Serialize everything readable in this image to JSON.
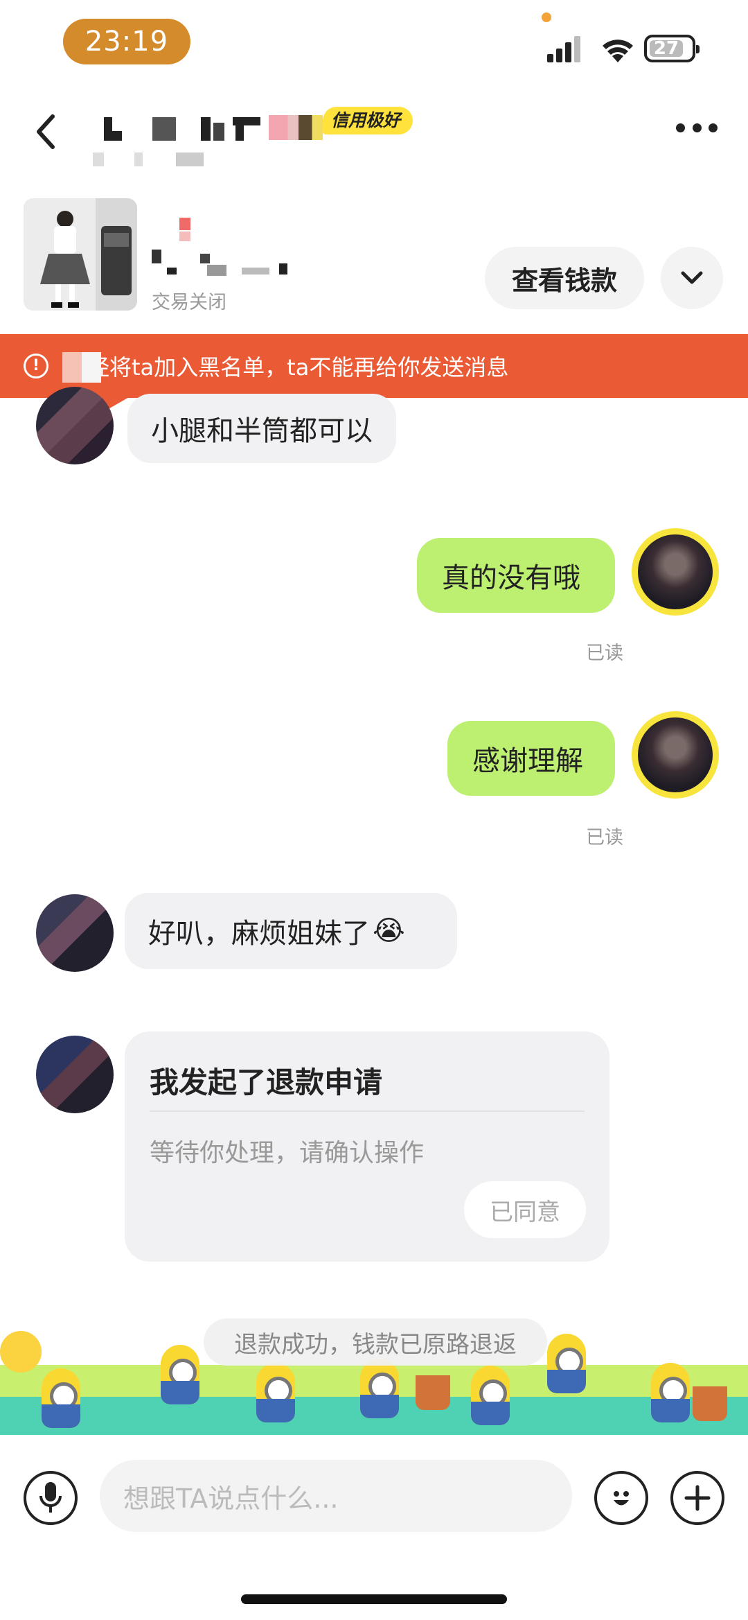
{
  "status_bar": {
    "time": "23:19",
    "battery": "27"
  },
  "header": {
    "credit_badge": "信用极好"
  },
  "product": {
    "tag": "交易关闭",
    "view_money_label": "查看钱款"
  },
  "banner": {
    "text": "经将ta加入黑名单，ta不能再给你发送消息"
  },
  "messages": [
    {
      "side": "left",
      "text": "小腿和半筒都可以"
    },
    {
      "side": "right",
      "text": "真的没有哦",
      "status": "已读"
    },
    {
      "side": "right",
      "text": "感谢理解",
      "status": "已读"
    },
    {
      "side": "left",
      "text": "好叭，麻烦姐妹了",
      "emoji": "😭"
    }
  ],
  "refund_card": {
    "title": "我发起了退款申请",
    "subtitle": "等待你处理，请确认操作",
    "button": "已同意"
  },
  "system_tip": "退款成功，钱款已原路退返",
  "input": {
    "placeholder": "想跟TA说点什么..."
  },
  "colors": {
    "accent_orange": "#ea5a35",
    "bubble_green": "#bdef71",
    "badge_yellow": "#ffe33c",
    "time_pill": "#d48b2c"
  },
  "icons": [
    "back-chevron-icon",
    "more-icon",
    "chevron-down-icon",
    "warning-icon",
    "mic-icon",
    "emoji-icon",
    "plus-icon"
  ]
}
